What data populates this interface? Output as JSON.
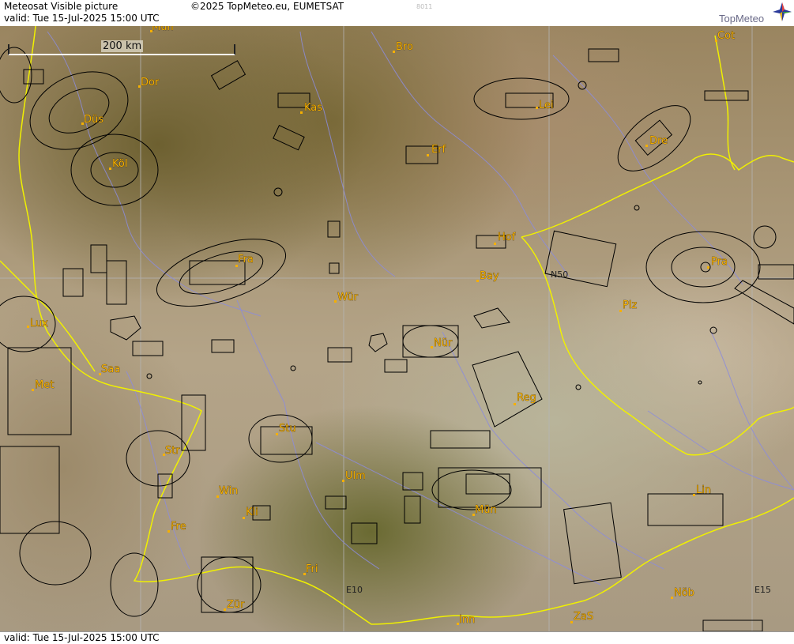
{
  "header": {
    "title": "Meteosat Visible picture",
    "valid": "valid:  Tue  15-Jul-2025  15:00 UTC",
    "copyright": "©2025 TopMeteo.eu, EUMETSAT",
    "code": "8011",
    "logo": "TopMeteo"
  },
  "footer": {
    "valid": "valid:  Tue  15-Jul-2025  15:00 UTC"
  },
  "scale": {
    "label": "200 km"
  },
  "grid": {
    "n50": "N50",
    "e10": "E10",
    "e15": "E15"
  },
  "cities": {
    "mun_top": "Mün",
    "dor": "Dor",
    "dus": "Düs",
    "kol": "Köl",
    "kas": "Kas",
    "bro": "Bro",
    "erf": "Erf",
    "lei": "Lei",
    "dre": "Dre",
    "cot": "Cot",
    "fra": "Fra",
    "hof": "Hof",
    "bay": "Bay",
    "pra": "Pra",
    "wur": "Wür",
    "nur": "Nür",
    "plz": "Plz",
    "lux": "Lux",
    "saa": "Saa",
    "met": "Met",
    "reg": "Reg",
    "stu": "Stu",
    "str": "Str",
    "win": "Win",
    "ulm": "Ulm",
    "kli": "Kli",
    "fre": "Fre",
    "mun": "Mün",
    "lin": "Lin",
    "fri": "Fri",
    "zur": "Zür",
    "inn": "Inn",
    "zas": "ZaS",
    "nob": "Nöb"
  },
  "colors": {
    "city": "#f5b000",
    "border": "#f0f000",
    "river": "#8c8cdc",
    "grid": "#b4b4b4",
    "airspace": "#000000"
  }
}
